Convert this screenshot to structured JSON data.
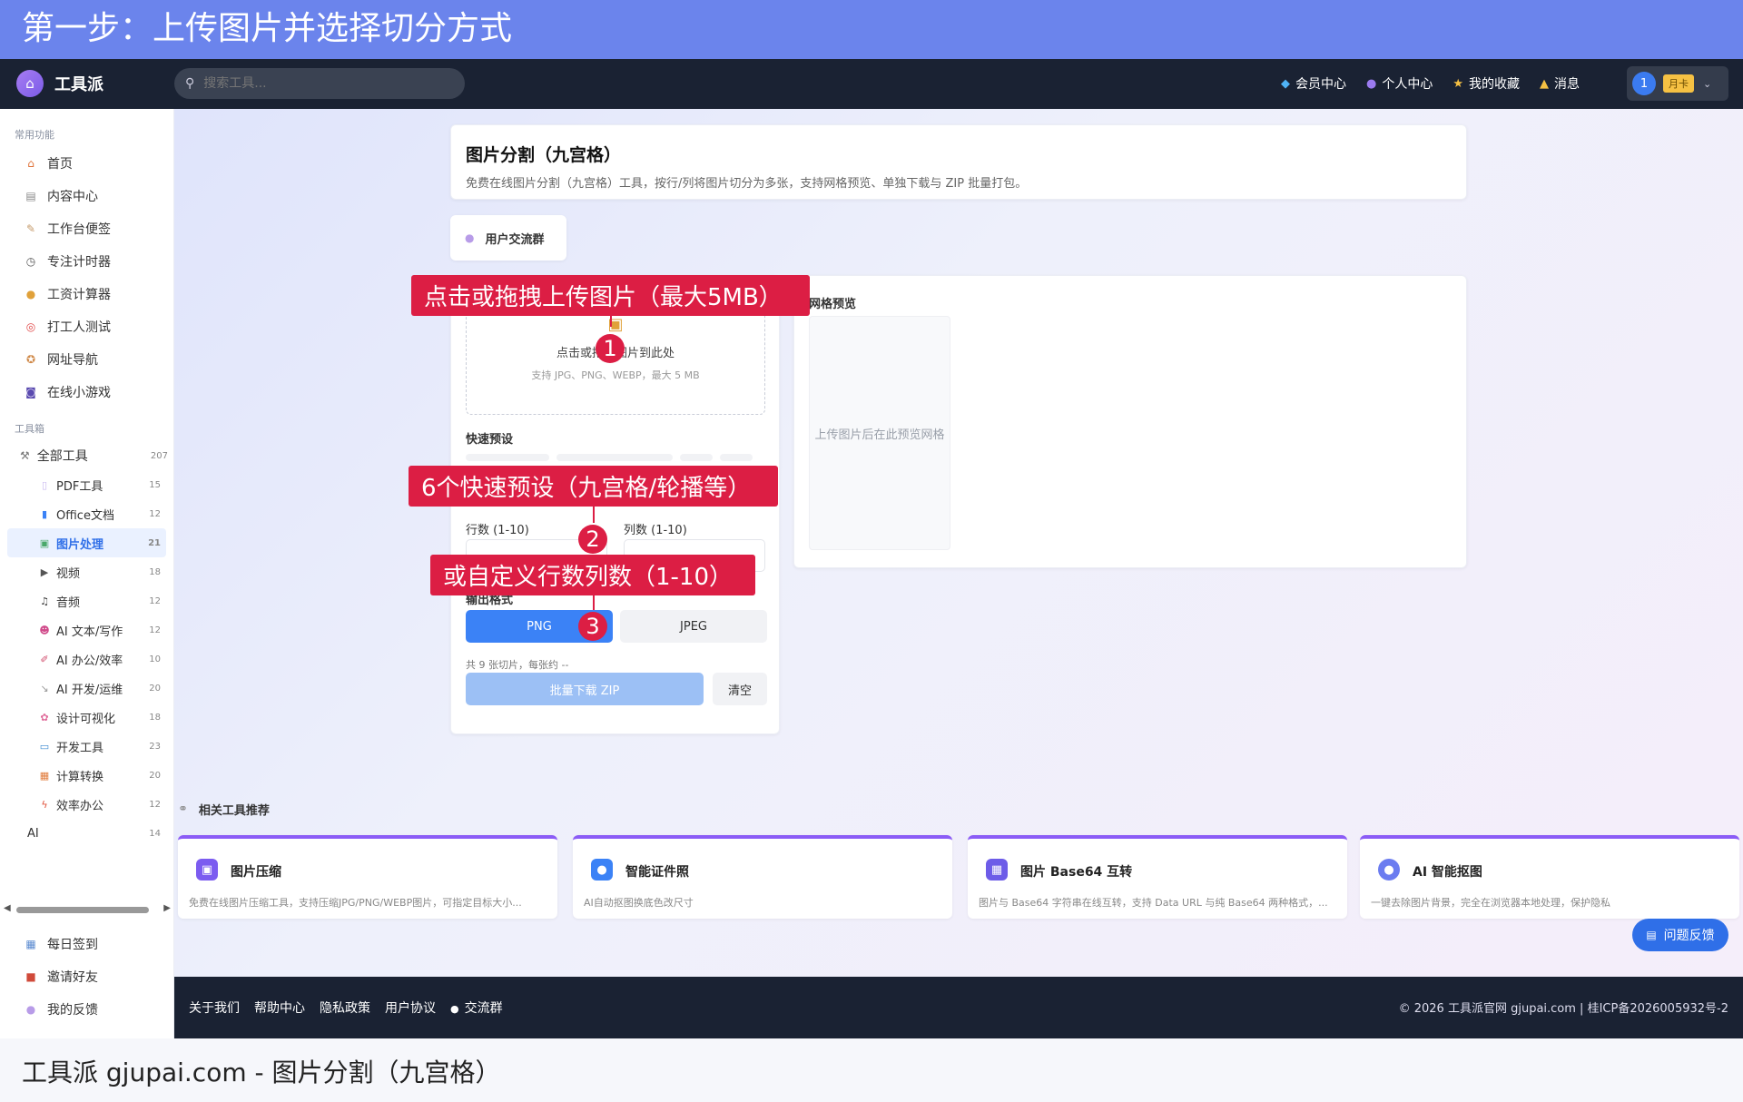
{
  "banner_top": "第一步：上传图片并选择切分方式",
  "banner_bottom": "工具派 gjupai.com - 图片分割（九宫格）",
  "navbar": {
    "brand": "工具派",
    "search_placeholder": "搜索工具...",
    "links": [
      {
        "icon": "diamond-icon",
        "label": "会员中心"
      },
      {
        "icon": "user-icon",
        "label": "个人中心"
      },
      {
        "icon": "star-icon",
        "label": "我的收藏"
      },
      {
        "icon": "bell-icon",
        "label": "消息"
      }
    ],
    "avatar_text": "1",
    "plan_badge": "月卡"
  },
  "sidebar": {
    "common_title": "常用功能",
    "common": [
      {
        "icon": "home-icon",
        "label": "首页"
      },
      {
        "icon": "newspaper-icon",
        "label": "内容中心"
      },
      {
        "icon": "memo-icon",
        "label": "工作台便签"
      },
      {
        "icon": "stopwatch-icon",
        "label": "专注计时器"
      },
      {
        "icon": "money-bag-icon",
        "label": "工资计算器"
      },
      {
        "icon": "target-icon",
        "label": "打工人测试"
      },
      {
        "icon": "compass-icon",
        "label": "网址导航"
      },
      {
        "icon": "gamepad-icon",
        "label": "在线小游戏"
      }
    ],
    "tools_title": "工具箱",
    "all_tools": {
      "label": "全部工具",
      "count": "207"
    },
    "categories": [
      {
        "icon": "pdf-icon",
        "label": "PDF工具",
        "count": "15"
      },
      {
        "icon": "office-icon",
        "label": "Office文档",
        "count": "12"
      },
      {
        "icon": "image-icon",
        "label": "图片处理",
        "count": "21"
      },
      {
        "icon": "video-icon",
        "label": "视频",
        "count": "18"
      },
      {
        "icon": "music-icon",
        "label": "音频",
        "count": "12"
      },
      {
        "icon": "robot-icon",
        "label": "AI 文本/写作",
        "count": "12"
      },
      {
        "icon": "ai-office-icon",
        "label": "AI 办公/效率",
        "count": "10"
      },
      {
        "icon": "wrench-icon",
        "label": "AI 开发/运维",
        "count": "20"
      },
      {
        "icon": "palette-icon",
        "label": "设计可视化",
        "count": "18"
      },
      {
        "icon": "laptop-icon",
        "label": "开发工具",
        "count": "23"
      },
      {
        "icon": "calculator-icon",
        "label": "计算转换",
        "count": "20"
      },
      {
        "icon": "bolt-icon",
        "label": "效率办公",
        "count": "12"
      },
      {
        "icon": "",
        "label": "AI",
        "count": "14"
      }
    ],
    "bottom": [
      {
        "icon": "calendar-icon",
        "label": "每日签到"
      },
      {
        "icon": "gift-icon",
        "label": "邀请好友"
      },
      {
        "icon": "chat-icon",
        "label": "我的反馈"
      }
    ]
  },
  "tool": {
    "title": "图片分割（九宫格）",
    "description": "免费在线图片分割（九宫格）工具，按行/列将图片切分为多张，支持网格预览、单独下载与 ZIP 批量打包。",
    "group_chip": "用户交流群",
    "upload_main": "点击或拖拽图片到此处",
    "upload_hint": "支持 JPG、PNG、WEBP，最大 5 MB",
    "presets_label": "快速预设",
    "rows_label": "行数 (1-10)",
    "cols_label": "列数 (1-10)",
    "format_label": "输出格式",
    "format_png": "PNG",
    "format_jpeg": "JPEG",
    "summary": "共 9 张切片，每张约 --",
    "zip_button": "批量下载 ZIP",
    "clear_button": "清空",
    "preview_title": "网格预览",
    "preview_empty": "上传图片后在此预览网格"
  },
  "callouts": [
    {
      "text": "点击或拖拽上传图片（最大5MB）",
      "num": "1"
    },
    {
      "text": "6个快速预设（九宫格/轮播等）",
      "num": "2"
    },
    {
      "text": "或自定义行数列数（1-10）",
      "num": "3"
    }
  ],
  "related": {
    "title": "相关工具推荐",
    "items": [
      {
        "title": "图片压缩",
        "desc": "免费在线图片压缩工具，支持压缩JPG/PNG/WEBP图片，可指定目标大小...",
        "color": "#7c5cf0"
      },
      {
        "title": "智能证件照",
        "desc": "AI自动抠图换底色改尺寸",
        "color": "#3b82f6"
      },
      {
        "title": "图片 Base64 互转",
        "desc": "图片与 Base64 字符串在线互转，支持 Data URL 与纯 Base64 两种格式，...",
        "color": "#6d5ce8"
      },
      {
        "title": "AI 智能抠图",
        "desc": "一键去除图片背景，完全在浏览器本地处理，保护隐私",
        "color": "#6b7cf0"
      }
    ]
  },
  "feedback_button": "问题反馈",
  "footer": {
    "links": [
      "关于我们",
      "帮助中心",
      "隐私政策",
      "用户协议",
      "交流群"
    ],
    "copyright": "© 2026 工具派官网 gjupai.com | 桂ICP备2026005932号-2"
  }
}
